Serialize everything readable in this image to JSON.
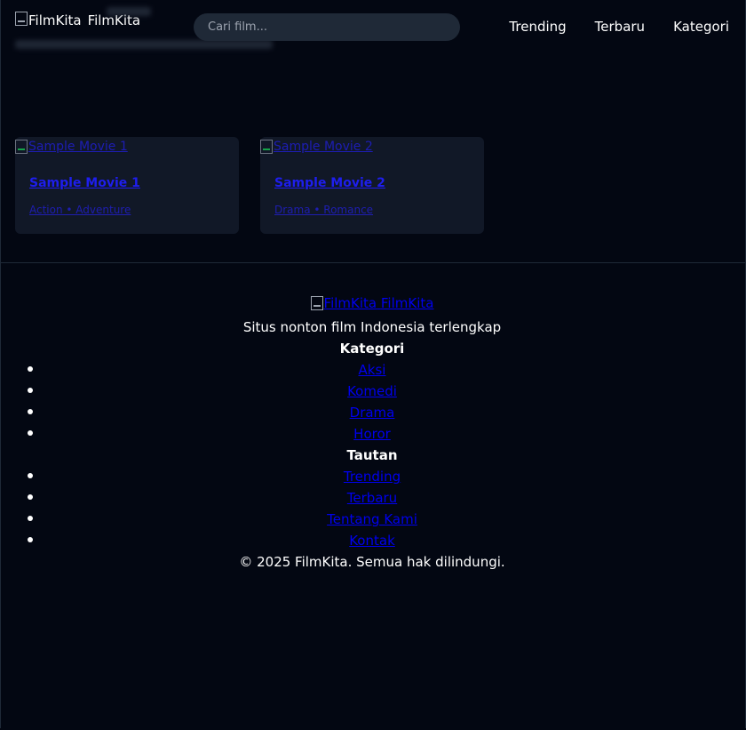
{
  "header": {
    "logo_alt": "FilmKita",
    "brand": "FilmKita",
    "search_placeholder": "Cari film...",
    "nav": [
      "Trending",
      "Terbaru",
      "Kategori"
    ]
  },
  "movies": [
    {
      "poster_alt": "Sample Movie 1",
      "title": "Sample Movie 1",
      "genres": "Action • Adventure"
    },
    {
      "poster_alt": "Sample Movie 2",
      "title": "Sample Movie 2",
      "genres": "Drama • Romance"
    }
  ],
  "footer": {
    "logo_alt": "FilmKita",
    "brand": "FilmKita",
    "tagline": "Situs nonton film Indonesia terlengkap",
    "kategori_heading": "Kategori",
    "kategori": [
      "Aksi",
      "Komedi",
      "Drama",
      "Horor"
    ],
    "tautan_heading": "Tautan",
    "tautan": [
      "Trending",
      "Terbaru",
      "Tentang Kami",
      "Kontak"
    ],
    "copyright": "© 2025 FilmKita. Semua hak dilindungi."
  },
  "colors": {
    "background": "#030712",
    "card": "#111827",
    "search_bg": "#1f2937",
    "link": "#0000ee"
  }
}
